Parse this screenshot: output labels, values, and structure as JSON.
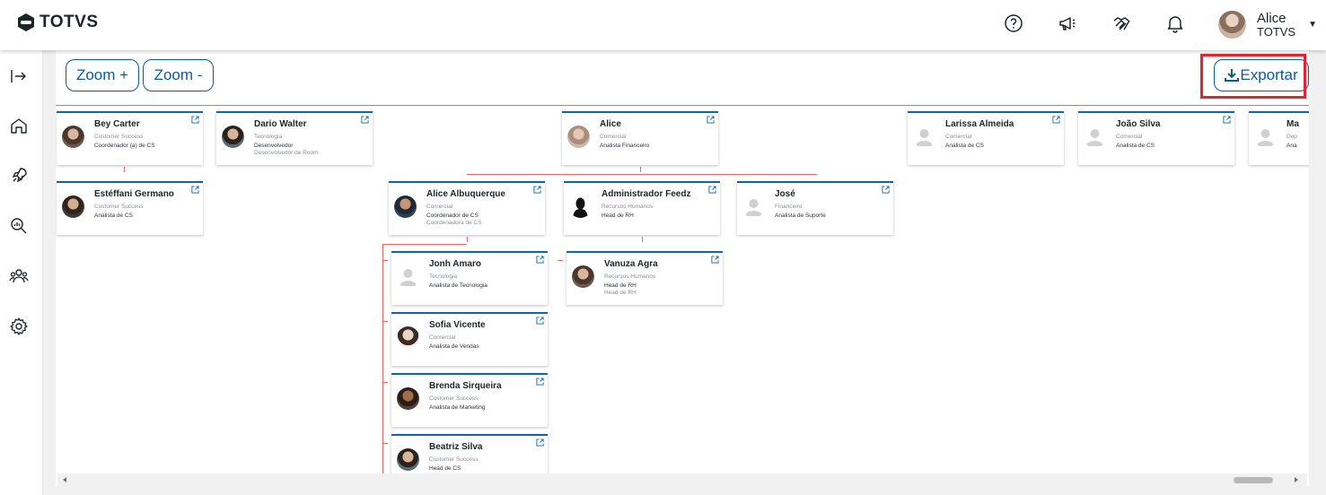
{
  "header": {
    "logo_text": "TOTVS",
    "user": {
      "name": "Alice",
      "org": "TOTVS"
    },
    "icons": [
      "help-icon",
      "megaphone-icon",
      "handshake-icon",
      "bell-icon"
    ]
  },
  "sidebar": {
    "items": [
      "expand-icon",
      "home-icon",
      "rocket-icon",
      "search-analytics-icon",
      "people-icon",
      "gear-icon"
    ]
  },
  "toolbar": {
    "zoom_in_label": "Zoom +",
    "zoom_out_label": "Zoom -",
    "export_label": "Exportar"
  },
  "org": {
    "roots": [
      {
        "name": "Bey Carter",
        "dept": "Customer Success",
        "role": "Coordenador (a) de CS",
        "role2": ""
      },
      {
        "name": "Dario Walter",
        "dept": "Tecnologia",
        "role": "Desenvolvedor",
        "role2": "Desenvolvedor de Room"
      },
      {
        "name": "Alice",
        "dept": "Comercial",
        "role": "Analista Financeiro",
        "role2": ""
      },
      {
        "name": "Larissa Almeida",
        "dept": "Comercial",
        "role": "Analista de CS",
        "role2": ""
      },
      {
        "name": "João Silva",
        "dept": "Comercial",
        "role": "Analista de CS",
        "role2": ""
      },
      {
        "name": "Ma",
        "dept": "Dep",
        "role": "Ana",
        "role2": ""
      }
    ],
    "level2": [
      {
        "name": "Estéffani Germano",
        "dept": "Customer Success",
        "role": "Analista de CS",
        "role2": ""
      },
      {
        "name": "Alice Albuquerque",
        "dept": "Comercial",
        "role": "Coordenador de CS",
        "role2": "Coordenadora de CS"
      },
      {
        "name": "Administrador Feedz",
        "dept": "Recursos Humanos",
        "role": "Head de RH",
        "role2": ""
      },
      {
        "name": "José",
        "dept": "Financeiro",
        "role": "Analista de Suporte",
        "role2": ""
      }
    ],
    "level3": [
      {
        "name": "Jonh Amaro",
        "dept": "Tecnologia",
        "role": "Analista de Tecnologia",
        "role2": ""
      },
      {
        "name": "Sofia Vicente",
        "dept": "Comercial",
        "role": "Analista de Vendas",
        "role2": ""
      },
      {
        "name": "Brenda Sirqueira",
        "dept": "Customer Success",
        "role": "Analista de Marketing",
        "role2": ""
      },
      {
        "name": "Beatriz Silva",
        "dept": "Customer Success",
        "role": "Head de CS",
        "role2": ""
      },
      {
        "name": "Vanuza Agra",
        "dept": "Recursos Humanos",
        "role": "Head de RH",
        "role2": "Head de RH"
      }
    ]
  },
  "colors": {
    "primary": "#0c5c94",
    "card_accent": "#0b67a8",
    "connector": "#e36a6a",
    "highlight": "#e8232d"
  }
}
